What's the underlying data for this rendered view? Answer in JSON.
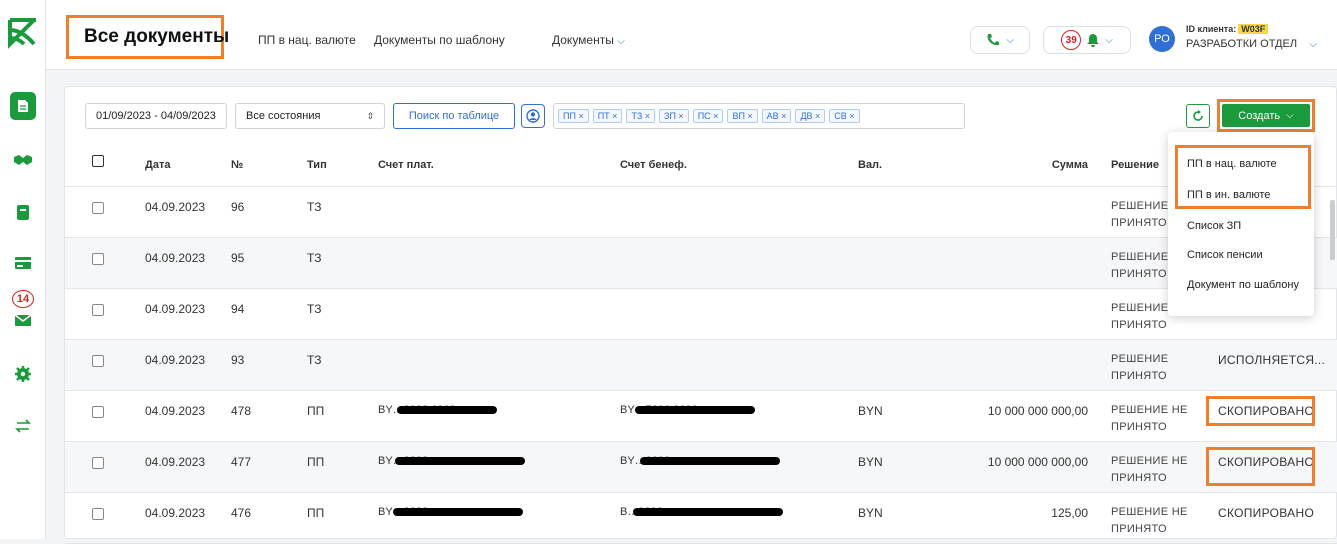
{
  "rail": {
    "badge_count": "14"
  },
  "header": {
    "title": "Все документы",
    "links": [
      "ПП в нац. валюте",
      "Документы по шаблону",
      "Документы"
    ],
    "notif_count": "39",
    "avatar_initials": "РО",
    "client_label": "ID клиента:",
    "client_id": "W03F",
    "client_org": "РАЗРАБОТКИ ОТДЕЛ"
  },
  "filters": {
    "date_range": "01/09/2023 - 04/09/2023",
    "state": "Все состояния",
    "search_button": "Поиск по таблице",
    "chips": [
      "ПП ×",
      "ПТ ×",
      "ТЗ ×",
      "ЗП ×",
      "ПС ×",
      "ВП ×",
      "АВ ×",
      "ДВ ×",
      "СВ ×"
    ],
    "create_button": "Создать"
  },
  "table": {
    "columns": [
      "Дата",
      "№",
      "Тип",
      "Счет плат.",
      "Счет бенеф.",
      "Вал.",
      "Сумма",
      "Решение"
    ],
    "rows": [
      {
        "date": "04.09.2023",
        "num": "96",
        "type": "ТЗ",
        "payer": "",
        "benef": "",
        "cur": "",
        "amount": "",
        "decision1": "РЕШЕНИЕ Н",
        "decision2": "ПРИНЯТО",
        "status": ""
      },
      {
        "date": "04.09.2023",
        "num": "95",
        "type": "ТЗ",
        "payer": "",
        "benef": "",
        "cur": "",
        "amount": "",
        "decision1": "РЕШЕНИЕ Н",
        "decision2": "ПРИНЯТО",
        "status": ""
      },
      {
        "date": "04.09.2023",
        "num": "94",
        "type": "ТЗ",
        "payer": "",
        "benef": "",
        "cur": "",
        "amount": "",
        "decision1": "РЕШЕНИЕ Н",
        "decision2": "ПРИНЯТО",
        "status": ""
      },
      {
        "date": "04.09.2023",
        "num": "93",
        "type": "ТЗ",
        "payer": "",
        "benef": "",
        "cur": "",
        "amount": "",
        "decision1": "РЕШЕНИЕ",
        "decision2": "ПРИНЯТО",
        "status": "ИСПОЛНЯЕТСЯ..."
      },
      {
        "date": "04.09.2023",
        "num": "478",
        "type": "ПП",
        "payer": "BY…0000 0000",
        "benef": "BY…7000 0000",
        "cur": "BYN",
        "amount": "10 000 000 000,00",
        "decision1": "РЕШЕНИЕ НЕ",
        "decision2": "ПРИНЯТО",
        "status": "СКОПИРОВАНО"
      },
      {
        "date": "04.09.2023",
        "num": "477",
        "type": "ПП",
        "payer": "BY…0000",
        "benef": "BY…0000",
        "cur": "BYN",
        "amount": "10 000 000 000,00",
        "decision1": "РЕШЕНИЕ НЕ",
        "decision2": "ПРИНЯТО",
        "status": "СКОПИРОВАНО"
      },
      {
        "date": "04.09.2023",
        "num": "476",
        "type": "ПП",
        "payer": "BY…0000",
        "benef": "B…0000",
        "cur": "BYN",
        "amount": "125,00",
        "decision1": "РЕШЕНИЕ НЕ",
        "decision2": "ПРИНЯТО",
        "status": "СКОПИРОВАНО"
      }
    ]
  },
  "menu": {
    "items": [
      "ПП в нац. валюте",
      "ПП в ин. валюте",
      "Список ЗП",
      "Список пенсии",
      "Документ по шаблону"
    ]
  }
}
